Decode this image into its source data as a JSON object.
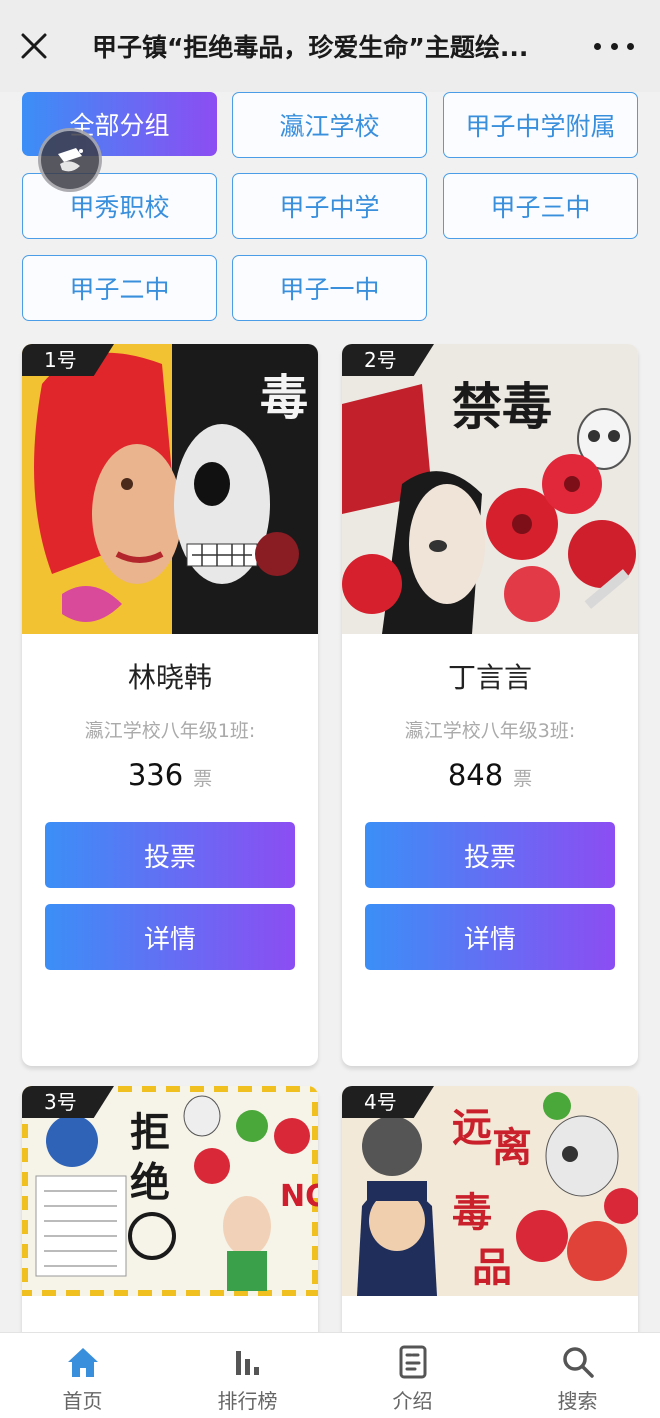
{
  "header": {
    "title": "甲子镇“拒绝毒品，珍爱生命”主题绘..."
  },
  "groups": [
    {
      "label": "全部分组",
      "active": true
    },
    {
      "label": "瀛江学校",
      "active": false
    },
    {
      "label": "甲子中学附属",
      "active": false
    },
    {
      "label": "甲秀职校",
      "active": false
    },
    {
      "label": "甲子中学",
      "active": false
    },
    {
      "label": "甲子三中",
      "active": false
    },
    {
      "label": "甲子二中",
      "active": false
    },
    {
      "label": "甲子一中",
      "active": false
    }
  ],
  "entries": [
    {
      "number": "1号",
      "name": "林晓韩",
      "school": "瀛江学校八年级1班:",
      "votes": "336",
      "vote_unit": "票",
      "vote_label": "投票",
      "detail_label": "详情"
    },
    {
      "number": "2号",
      "name": "丁言言",
      "school": "瀛江学校八年级3班:",
      "votes": "848",
      "vote_unit": "票",
      "vote_label": "投票",
      "detail_label": "详情"
    },
    {
      "number": "3号"
    },
    {
      "number": "4号"
    }
  ],
  "tabs": [
    {
      "label": "首页",
      "icon": "home-icon",
      "active": true
    },
    {
      "label": "排行榜",
      "icon": "ranking-icon",
      "active": false
    },
    {
      "label": "介绍",
      "icon": "intro-icon",
      "active": false
    },
    {
      "label": "搜索",
      "icon": "search-icon",
      "active": false
    }
  ],
  "colors": {
    "accent_start": "#3b8ff6",
    "accent_end": "#8c4df2",
    "group_border": "#4a9de6",
    "tab_active": "#3a8fdd"
  }
}
